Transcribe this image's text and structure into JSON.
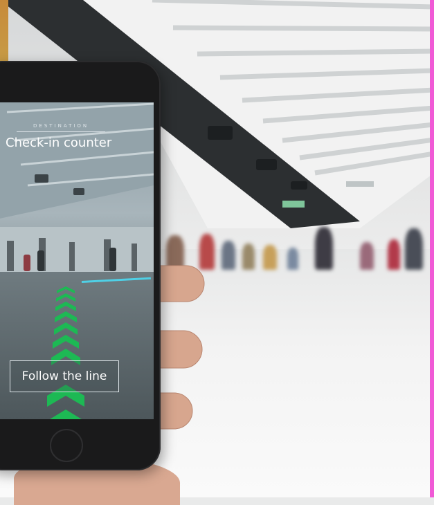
{
  "phone_app": {
    "destination_label": "DESTINATION",
    "destination_value": "Check-in counter",
    "action_button": "Follow the line"
  },
  "colors": {
    "guide_arrows": "#1db954",
    "guide_line": "#4fd0e6",
    "pink_edge": "#f05ad6"
  },
  "icons": {
    "arrows": "chevron-up-icon"
  }
}
